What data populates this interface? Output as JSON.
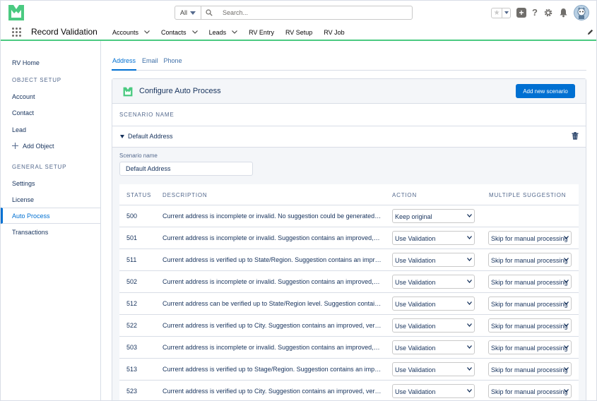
{
  "app": {
    "name": "Record Validation",
    "accent": "#4bca81",
    "brand_blue": "#0070d2"
  },
  "search": {
    "scope": "All",
    "placeholder": "Search..."
  },
  "nav": {
    "items": [
      {
        "label": "Accounts",
        "dropdown": true
      },
      {
        "label": "Contacts",
        "dropdown": true
      },
      {
        "label": "Leads",
        "dropdown": true
      },
      {
        "label": "RV Entry",
        "dropdown": false
      },
      {
        "label": "RV Setup",
        "dropdown": false
      },
      {
        "label": "RV Job",
        "dropdown": false
      }
    ]
  },
  "sidebar": {
    "home": "RV Home",
    "object_setup_heading": "OBJECT SETUP",
    "account": "Account",
    "contact": "Contact",
    "lead": "Lead",
    "add_object": "Add Object",
    "general_setup_heading": "GENERAL SETUP",
    "settings": "Settings",
    "license": "License",
    "auto_process": "Auto Process",
    "transactions": "Transactions"
  },
  "tabs": [
    "Address",
    "Email",
    "Phone"
  ],
  "card": {
    "title": "Configure Auto Process",
    "add_button": "Add new scenario",
    "scenario_column": "SCENARIO NAME",
    "scenario": {
      "name": "Default Address",
      "field_label": "Scenario name",
      "field_value": "Default Address"
    }
  },
  "table": {
    "headers": {
      "status": "STATUS",
      "description": "DESCRIPTION",
      "action": "ACTION",
      "multiple_suggestion": "MULTIPLE SUGGESTION"
    },
    "rows": [
      {
        "status": "500",
        "description": "Current address is incomplete or invalid. No suggestion could be generated for...",
        "action": "Keep original",
        "multiple_suggestion": ""
      },
      {
        "status": "501",
        "description": "Current address is incomplete or invalid. Suggestion contains an improved, ver...",
        "action": "Use Validation",
        "multiple_suggestion": "Skip for manual processing"
      },
      {
        "status": "511",
        "description": "Current address is verified up to State/Region. Suggestion contains an improve...",
        "action": "Use Validation",
        "multiple_suggestion": "Skip for manual processing"
      },
      {
        "status": "502",
        "description": "Current address is incomplete or invalid. Suggestion contains an improved, ver...",
        "action": "Use Validation",
        "multiple_suggestion": "Skip for manual processing"
      },
      {
        "status": "512",
        "description": "Current address can be verified up to State/Region level. Suggestion contains ...",
        "action": "Use Validation",
        "multiple_suggestion": "Skip for manual processing"
      },
      {
        "status": "522",
        "description": "Current address is verified up to City. Suggestion contains an improved, verifie...",
        "action": "Use Validation",
        "multiple_suggestion": "Skip for manual processing"
      },
      {
        "status": "503",
        "description": "Current address is incomplete or invalid. Suggestion contains an improved, ver...",
        "action": "Use Validation",
        "multiple_suggestion": "Skip for manual processing"
      },
      {
        "status": "513",
        "description": "Current address is verified up to Stage/Region. Suggestion contains an improv...",
        "action": "Use Validation",
        "multiple_suggestion": "Skip for manual processing"
      },
      {
        "status": "523",
        "description": "Current address is verified up to City. Suggestion contains an improved, verifie...",
        "action": "Use Validation",
        "multiple_suggestion": "Skip for manual processing"
      }
    ]
  },
  "icons": [
    "app-logo-icon",
    "search-icon",
    "favorite-star-icon",
    "add-icon",
    "help-icon",
    "settings-gear-icon",
    "notification-bell-icon",
    "avatar",
    "app-launcher-icon",
    "chevron-down-icon",
    "edit-pencil-icon",
    "plus-icon",
    "trash-icon"
  ]
}
